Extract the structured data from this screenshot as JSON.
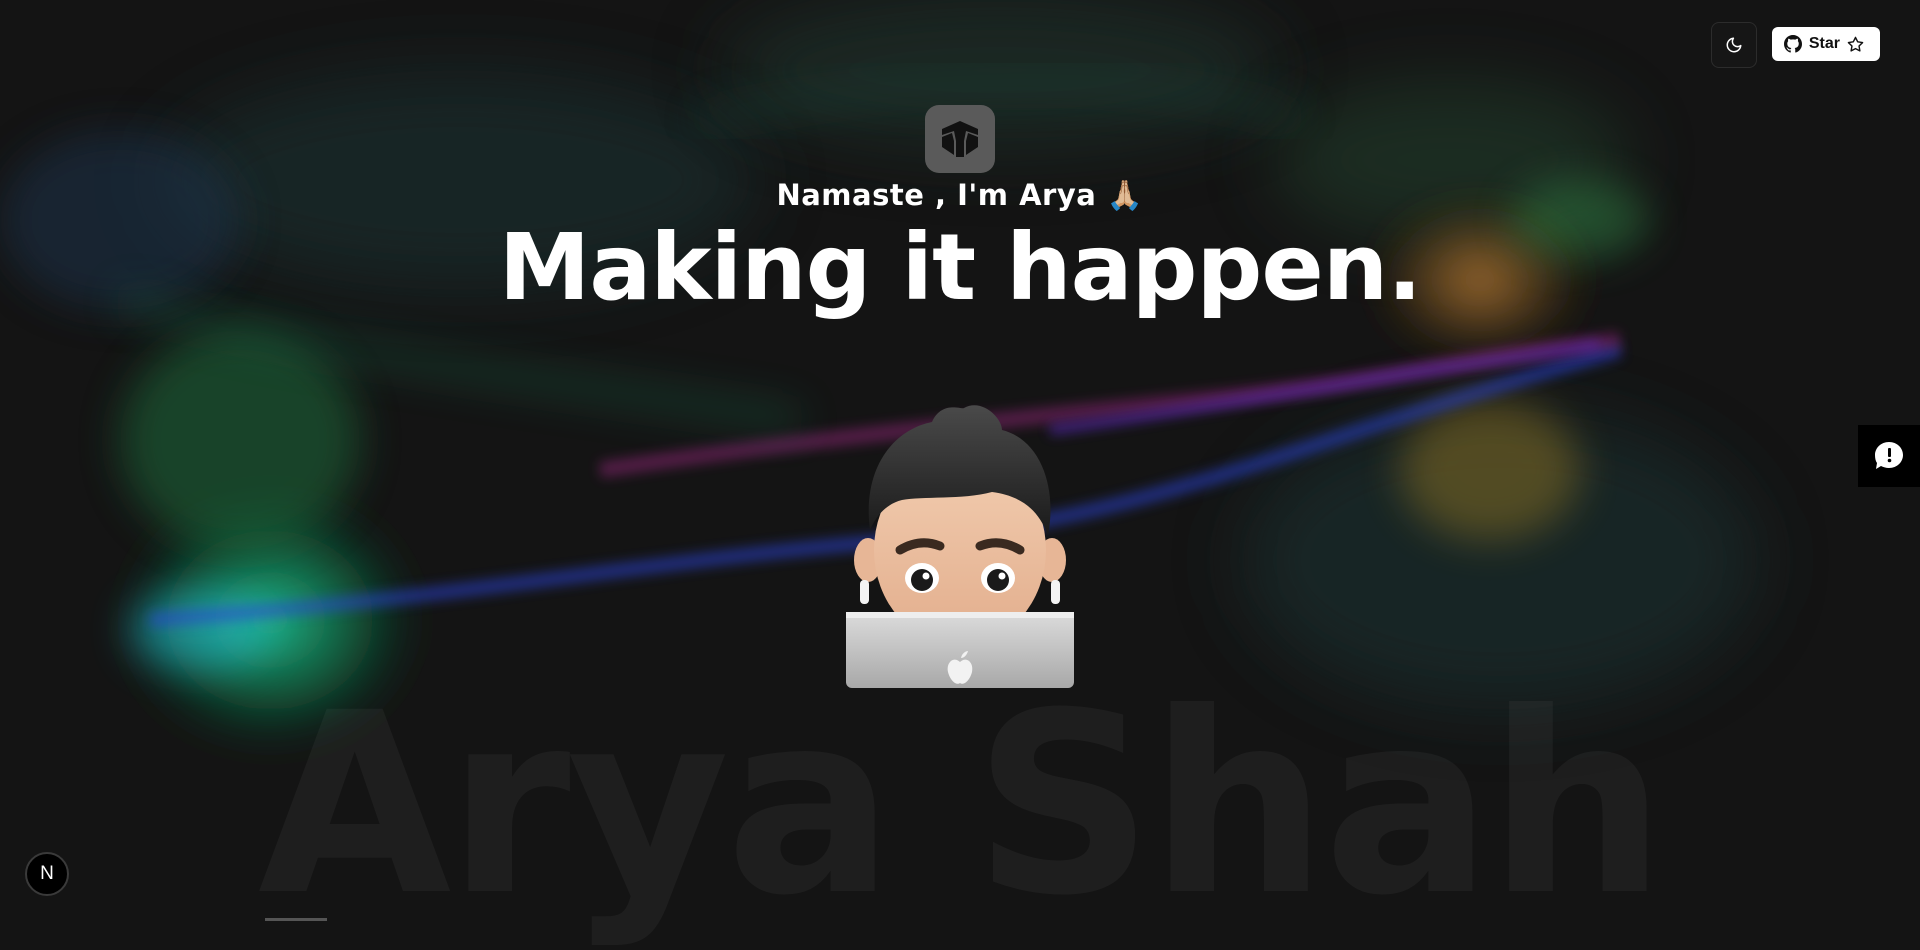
{
  "header": {
    "theme_toggle_icon": "moon-icon",
    "github_icon": "github-icon",
    "star_label": "Star",
    "star_icon": "star-outline-icon"
  },
  "hero": {
    "logo_icon": "shield-y-logo-icon",
    "greeting": "Namaste , I'm Arya 🙏🏼",
    "headline": "Making it happen.",
    "avatar": "memoji-laptop-avatar",
    "watermark": "Arya Shah"
  },
  "widgets": {
    "feedback_icon": "chat-bubble-icon",
    "next_badge": "N"
  },
  "colors": {
    "background": "#141414",
    "smoke_green": "#1fae6a",
    "smoke_cyan": "#18b6d2",
    "smoke_blue": "#3a4fd6",
    "smoke_magenta": "#b0308f",
    "smoke_orange": "#c9782a"
  }
}
